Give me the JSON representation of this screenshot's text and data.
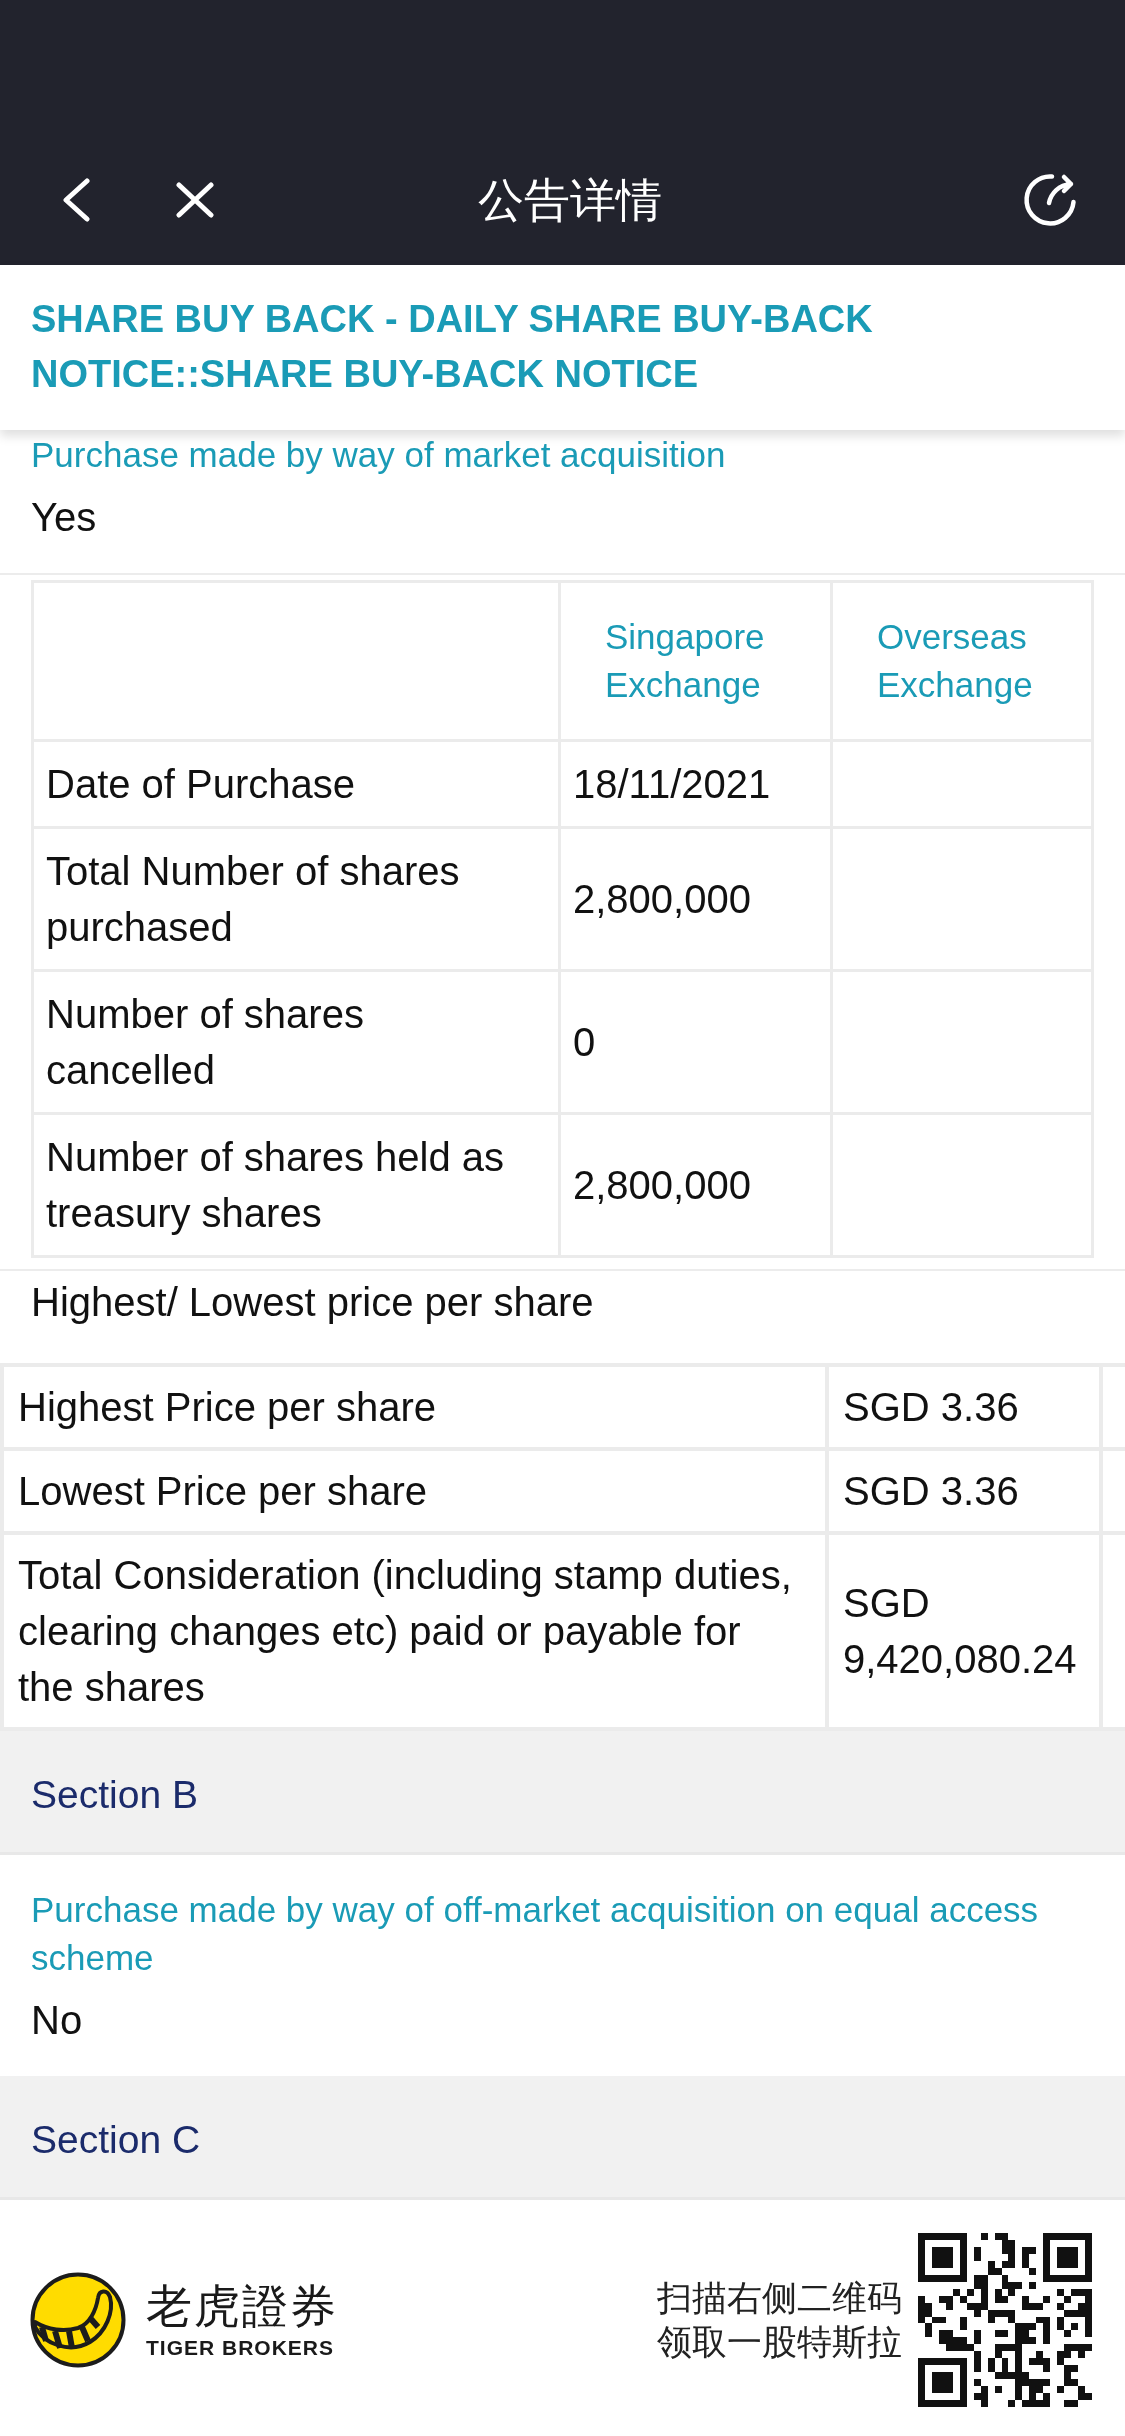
{
  "nav_bar": {
    "title": "公告详情"
  },
  "notice_title": "SHARE BUY BACK - DAILY SHARE BUY-BACK NOTICE::SHARE BUY-BACK NOTICE",
  "market_acquisition": {
    "label": "Purchase made by way of market acquisition",
    "value": "Yes"
  },
  "purchase_table": {
    "columns": [
      "Singapore Exchange",
      "Overseas Exchange"
    ],
    "rows": [
      {
        "label": "Date of Purchase",
        "values": [
          "18/11/2021"
        ]
      },
      {
        "label": "Total Number of shares purchased",
        "values": [
          "2,800,000"
        ]
      },
      {
        "label": "Number of shares cancelled",
        "values": [
          "0"
        ]
      },
      {
        "label": "Number of shares held as treasury shares",
        "values": [
          "2,800,000"
        ]
      }
    ]
  },
  "price_heading": "Highest/ Lowest price per share",
  "price_table": {
    "rows": [
      {
        "label": "Highest Price per share",
        "value": "SGD 3.36"
      },
      {
        "label": "Lowest Price per share",
        "value": "SGD 3.36"
      },
      {
        "label": "Total Consideration (including stamp duties, clearing changes etc) paid or payable for the shares",
        "value": "SGD 9,420,080.24"
      }
    ]
  },
  "section_b": {
    "title": "Section B",
    "label": "Purchase made by way of off-market acquisition on equal access scheme",
    "value": "No"
  },
  "section_c": {
    "title": "Section C"
  },
  "footer": {
    "brand_name": "老虎證券",
    "brand_subtitle": "TIGER BROKERS",
    "promo_lines": [
      "扫描右侧二维码",
      "领取一股特斯拉"
    ]
  }
}
